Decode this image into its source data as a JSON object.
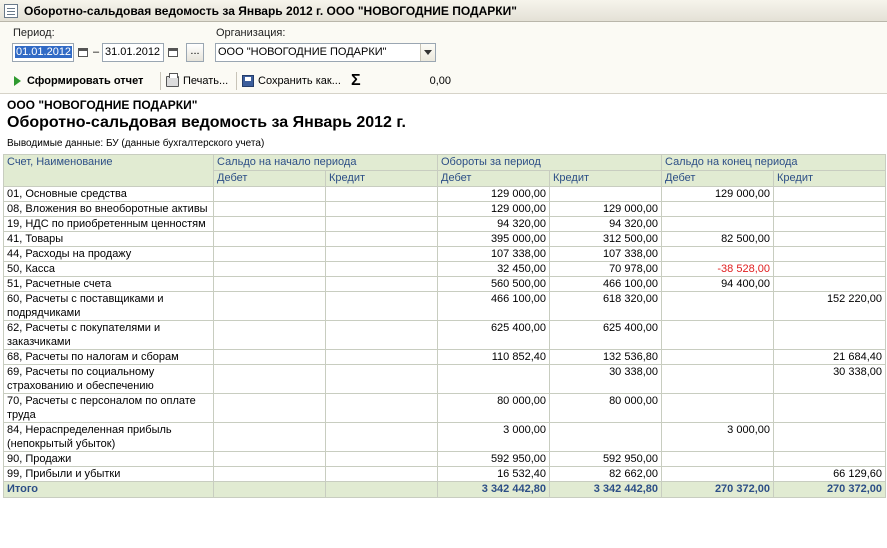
{
  "window": {
    "title": "Оборотно-сальдовая ведомость за Январь 2012 г. ООО \"НОВОГОДНИЕ ПОДАРКИ\""
  },
  "params": {
    "period_label": "Период:",
    "date_from": "01.01.2012",
    "date_separator": "–",
    "date_to": "31.01.2012",
    "dots_label": "...",
    "org_label": "Организация:",
    "org_value": "ООО \"НОВОГОДНИЕ ПОДАРКИ\""
  },
  "toolbar": {
    "generate_label": "Сформировать отчет",
    "print_label": "Печать...",
    "save_label": "Сохранить как...",
    "sigma_symbol": "Σ",
    "sigma_value": "0,00"
  },
  "report": {
    "org": "ООО \"НОВОГОДНИЕ ПОДАРКИ\"",
    "title": "Оборотно-сальдовая ведомость за Январь 2012 г.",
    "info": "Выводимые данные:  БУ (данные бухгалтерского учета)"
  },
  "table": {
    "headers": {
      "account": "Счет, Наименование",
      "opening": "Сальдо на начало периода",
      "turnover": "Обороты за период",
      "closing": "Сальдо на конец периода",
      "debit": "Дебет",
      "credit": "Кредит"
    },
    "rows": [
      {
        "name": "01, Основные средства",
        "od": "",
        "oc": "",
        "td": "129 000,00",
        "tc": "",
        "cd": "129 000,00",
        "cc": ""
      },
      {
        "name": "08, Вложения во внеоборотные активы",
        "od": "",
        "oc": "",
        "td": "129 000,00",
        "tc": "129 000,00",
        "cd": "",
        "cc": ""
      },
      {
        "name": "19, НДС по приобретенным ценностям",
        "od": "",
        "oc": "",
        "td": "94 320,00",
        "tc": "94 320,00",
        "cd": "",
        "cc": ""
      },
      {
        "name": "41, Товары",
        "od": "",
        "oc": "",
        "td": "395 000,00",
        "tc": "312 500,00",
        "cd": "82 500,00",
        "cc": ""
      },
      {
        "name": "44, Расходы на продажу",
        "od": "",
        "oc": "",
        "td": "107 338,00",
        "tc": "107 338,00",
        "cd": "",
        "cc": ""
      },
      {
        "name": "50, Касса",
        "od": "",
        "oc": "",
        "td": "32 450,00",
        "tc": "70 978,00",
        "cd": "-38 528,00",
        "cc": ""
      },
      {
        "name": "51, Расчетные счета",
        "od": "",
        "oc": "",
        "td": "560 500,00",
        "tc": "466 100,00",
        "cd": "94 400,00",
        "cc": ""
      },
      {
        "name": "60, Расчеты с поставщиками и подрядчиками",
        "od": "",
        "oc": "",
        "td": "466 100,00",
        "tc": "618 320,00",
        "cd": "",
        "cc": "152 220,00"
      },
      {
        "name": "62, Расчеты с покупателями и заказчиками",
        "od": "",
        "oc": "",
        "td": "625 400,00",
        "tc": "625 400,00",
        "cd": "",
        "cc": ""
      },
      {
        "name": "68, Расчеты по налогам и сборам",
        "od": "",
        "oc": "",
        "td": "110 852,40",
        "tc": "132 536,80",
        "cd": "",
        "cc": "21 684,40"
      },
      {
        "name": "69, Расчеты по социальному страхованию и обеспечению",
        "od": "",
        "oc": "",
        "td": "",
        "tc": "30 338,00",
        "cd": "",
        "cc": "30 338,00"
      },
      {
        "name": "70, Расчеты с персоналом по оплате труда",
        "od": "",
        "oc": "",
        "td": "80 000,00",
        "tc": "80 000,00",
        "cd": "",
        "cc": ""
      },
      {
        "name": "84, Нераспределенная прибыль (непокрытый убыток)",
        "od": "",
        "oc": "",
        "td": "3 000,00",
        "tc": "",
        "cd": "3 000,00",
        "cc": ""
      },
      {
        "name": "90, Продажи",
        "od": "",
        "oc": "",
        "td": "592 950,00",
        "tc": "592 950,00",
        "cd": "",
        "cc": ""
      },
      {
        "name": "99, Прибыли и убытки",
        "od": "",
        "oc": "",
        "td": "16 532,40",
        "tc": "82 662,00",
        "cd": "",
        "cc": "66 129,60"
      }
    ],
    "total": {
      "name": "Итого",
      "od": "",
      "oc": "",
      "td": "3 342 442,80",
      "tc": "3 342 442,80",
      "cd": "270 372,00",
      "cc": "270 372,00"
    }
  },
  "colors": {
    "header_bg": "#e1ebd2",
    "header_text": "#2c4e86",
    "negative": "#e02020",
    "selection": "#316ac5"
  }
}
